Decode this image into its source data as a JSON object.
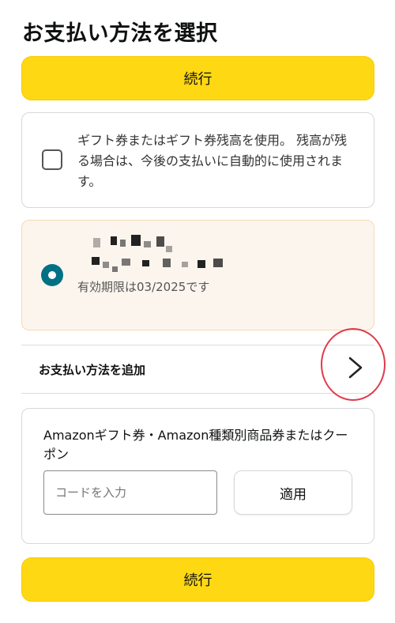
{
  "header": {
    "title": "お支払い方法を選択"
  },
  "actions": {
    "continue_label": "続行"
  },
  "gift_card": {
    "checkbox_checked": false,
    "text": "ギフト券またはギフト券残高を使用。 残高が残る場合は、今後の支払いに自動的に使用されます。"
  },
  "card_option": {
    "selected": true,
    "card_name_redacted": true,
    "expiry": "有効期限は03/2025です"
  },
  "add_payment": {
    "label": "お支払い方法を追加",
    "icon": "chevron-right-icon"
  },
  "coupon": {
    "label": "Amazonギフト券・Amazon種類別商品券またはクーポン",
    "input_placeholder": "コードを入力",
    "apply_label": "適用"
  },
  "colors": {
    "primary_button": "#ffd814",
    "radio_selected": "#007185",
    "selected_card_bg": "#fcf5ee",
    "annotation_circle": "#e03a4a"
  }
}
